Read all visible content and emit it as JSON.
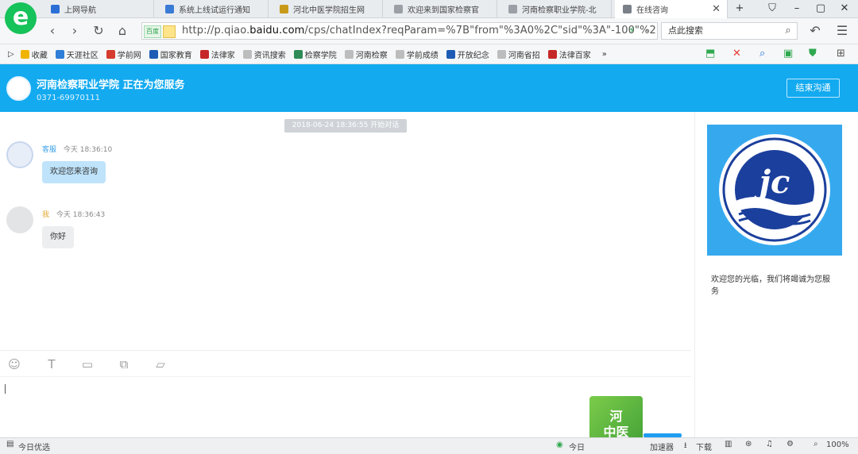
{
  "browser": {
    "logo_letter": "e",
    "tabs": [
      {
        "title": "上网导航",
        "icon_color": "#2b6fd6"
      },
      {
        "title": "系统上线试运行通知",
        "icon_color": "#3a7bd5"
      },
      {
        "title": "河北中医学院招生网",
        "icon_color": "#c99a1a"
      },
      {
        "title": "欢迎来到国家检察官",
        "icon_color": "#9aa0a6"
      },
      {
        "title": "河南检察职业学院-北",
        "icon_color": "#9aa0a6"
      },
      {
        "title": "在线咨询",
        "icon_color": "#7a8088",
        "active": true
      }
    ],
    "new_tab": "+",
    "window_buttons": [
      "⛉",
      "–",
      "▢",
      "✕"
    ],
    "address": {
      "badge": "百度",
      "url_prefix": "http://p.qiao.",
      "url_domain": "baidu.com",
      "url_suffix": "/cps/chatIndex?reqParam=%7B\"from\"%3A0%2C\"sid\"%3A\"-100\"%2"
    },
    "search_placeholder": "点此搜索",
    "bookmarks": [
      {
        "label": "收藏",
        "color": "#f0b400"
      },
      {
        "label": "天涯社区",
        "color": "#2f7fd8"
      },
      {
        "label": "学前网",
        "color": "#d53c2f"
      },
      {
        "label": "国家教育",
        "color": "#1e5bb5"
      },
      {
        "label": "法律家",
        "color": "#c62828"
      },
      {
        "label": "资讯搜索",
        "color": "#bdbdbd"
      },
      {
        "label": "检察学院",
        "color": "#2e8b57"
      },
      {
        "label": "河南检察",
        "color": "#bdbdbd"
      },
      {
        "label": "学前成绩",
        "color": "#bdbdbd"
      },
      {
        "label": "开放纪念",
        "color": "#1e5bb5"
      },
      {
        "label": "河南省招",
        "color": "#bdbdbd"
      },
      {
        "label": "法律百家",
        "color": "#c62828"
      }
    ]
  },
  "chat": {
    "header_title": "河南检察职业学院 正在为您服务",
    "header_phone": "0371-69970111",
    "end_button": "结束沟通",
    "system_message": "2018-06-24 18:36:55 开始对话",
    "messages": [
      {
        "sender": "客服",
        "time": "今天 18:36:10",
        "text": "欢迎您来咨询"
      },
      {
        "sender": "我",
        "time": "今天 18:36:43",
        "text": "你好"
      }
    ],
    "side_text": "欢迎您的光临，我们将竭诚为您服务",
    "logo_text": "jc"
  },
  "toolbar_icons": [
    "emoji-icon",
    "text-format-icon",
    "image-icon",
    "screenshot-icon",
    "folder-icon"
  ],
  "floating_badge": "河\n中医",
  "statusbar": {
    "left": "今日优选",
    "today": "今日",
    "items": [
      "加速器",
      "下载"
    ],
    "zoom": "100%"
  },
  "accent": "#13aaf0"
}
